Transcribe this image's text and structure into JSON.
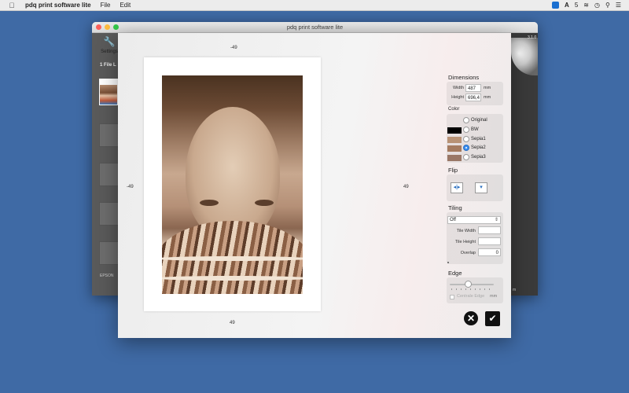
{
  "menubar": {
    "apple_icon": "apple-icon",
    "app_name": "pdq print software lite",
    "menus": [
      "File",
      "Edit"
    ],
    "status_badge": "5"
  },
  "window": {
    "title": "pdq print software lite",
    "settings_label": "Settings",
    "files_label": "1 File L",
    "printer_label": "EPSON",
    "version": "3.1.0",
    "bottom_unit": "m"
  },
  "dialog": {
    "offsets": {
      "top": "-49",
      "left": "-49",
      "right": "49",
      "bottom": "49"
    },
    "dimensions": {
      "title": "Dimensions",
      "width_label": "Width",
      "width_value": "487",
      "height_label": "Height",
      "height_value": "696,4",
      "unit": "mm"
    },
    "color": {
      "title": "Color",
      "options": [
        {
          "label": "Original",
          "swatch": null,
          "selected": false
        },
        {
          "label": "BW",
          "swatch": "#000000",
          "selected": false
        },
        {
          "label": "Sepia1",
          "swatch": "#b89275",
          "selected": false
        },
        {
          "label": "Sepia2",
          "swatch": "#a57b60",
          "selected": true
        },
        {
          "label": "Sepia3",
          "swatch": "#9a7766",
          "selected": false
        }
      ]
    },
    "flip": {
      "title": "Flip"
    },
    "tiling": {
      "title": "Tiling",
      "mode": "Off",
      "tile_width_label": "Tile Width",
      "tile_height_label": "Tile Height",
      "overlap_label": "Overlap",
      "overlap_value": "0"
    },
    "edge": {
      "title": "Edge",
      "checkbox_label": "Centrale Edge",
      "unit": "mm"
    }
  }
}
